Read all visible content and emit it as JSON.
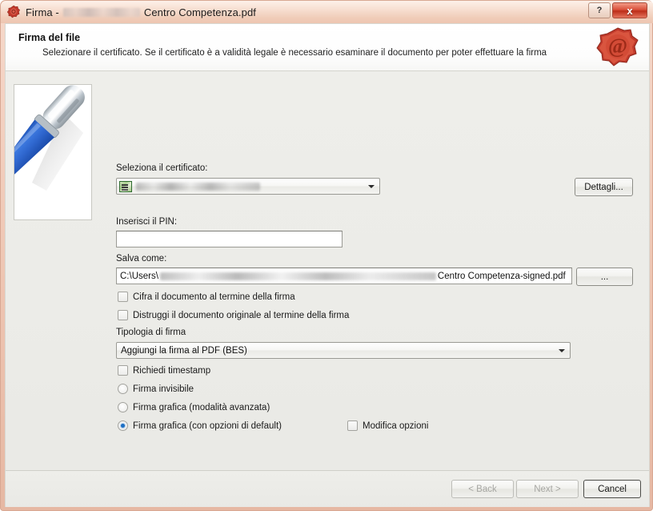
{
  "window": {
    "title_prefix": "Firma -",
    "title_document": "Centro Competenza.pdf",
    "icon": "wax-seal-icon",
    "help_button": "?",
    "close_button": "x"
  },
  "header": {
    "title": "Firma del file",
    "subtitle": "Selezionare il certificato. Se il certificato è a validità legale è necessario esaminare il documento per poter effettuare la firma",
    "seal_glyph": "@"
  },
  "form": {
    "certificate_label": "Seleziona il certificato:",
    "certificate_value": "",
    "details_button": "Dettagli...",
    "pin_label": "Inserisci il PIN:",
    "pin_value": "",
    "saveas_label": "Salva come:",
    "saveas_prefix": "C:\\Users\\",
    "saveas_suffix": "Centro Competenza-signed.pdf",
    "browse_button": "...",
    "encrypt_checkbox": "Cifra il documento al termine della firma",
    "destroy_checkbox": "Distruggi il documento originale al termine della firma",
    "signature_type_label": "Tipologia di firma",
    "signature_type_value": "Aggiungi la firma al PDF (BES)",
    "timestamp_checkbox": "Richiedi timestamp",
    "radio_invisible": "Firma invisibile",
    "radio_graphic_advanced": "Firma grafica (modalità avanzata)",
    "radio_graphic_default": "Firma grafica (con opzioni di default)",
    "modify_options_checkbox": "Modifica opzioni",
    "selected_radio": "radio_graphic_default"
  },
  "footer": {
    "back_button": "< Back",
    "next_button": "Next >",
    "cancel_button": "Cancel"
  },
  "colors": {
    "frame": "#eec5b2",
    "close": "#d9503a",
    "seal": "#c0392b",
    "radio_selected": "#1d6fc4",
    "body": "#eeeeea"
  }
}
